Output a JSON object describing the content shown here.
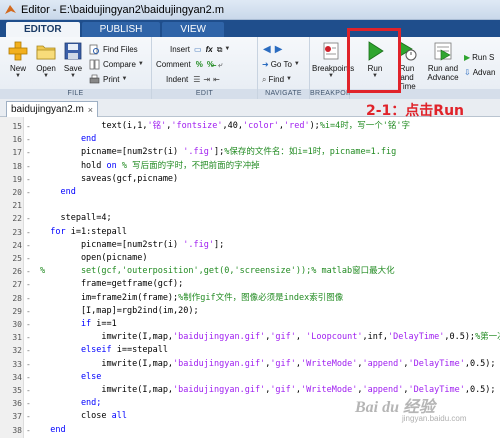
{
  "window": {
    "title": "Editor - E:\\baidujingyan2\\baidujingyan2.m"
  },
  "ribbon_tabs": [
    "EDITOR",
    "PUBLISH",
    "VIEW"
  ],
  "file_group": {
    "label": "FILE",
    "new": "New",
    "open": "Open",
    "save": "Save",
    "find_files": "Find Files",
    "compare": "Compare",
    "print": "Print"
  },
  "edit_group": {
    "label": "EDIT",
    "insert": "Insert",
    "comment": "Comment",
    "indent": "Indent"
  },
  "navigate_group": {
    "label": "NAVIGATE",
    "go_to": "Go To",
    "find": "Find"
  },
  "breakpoints_group": {
    "label": "BREAKPOINTS",
    "breakpoints": "Breakpoints"
  },
  "run_group": {
    "run": "Run",
    "run_and_time": "Run and Time",
    "run_and_advance": "Run and Advance",
    "run_section": "Run S",
    "advance": "Advan"
  },
  "doc_tab": {
    "name": "baidujingyan2.m"
  },
  "annotation": "2-1：点击Run",
  "watermark": {
    "main": "Bai du 经验",
    "sub": "jingyan.baidu.com"
  },
  "colors": {
    "highlight": "#e0232a",
    "keyword": "#0000ff",
    "string": "#a020f0",
    "comment": "#228b22"
  },
  "code_lines": [
    {
      "num": "15",
      "parts": [
        [
          "",
          "            text(i,1,"
        ],
        [
          "str",
          "'铭'"
        ],
        [
          "",
          ","
        ],
        [
          "str",
          "'fontsize'"
        ],
        [
          "",
          ",40,"
        ],
        [
          "str",
          "'color'"
        ],
        [
          "",
          ","
        ],
        [
          "str",
          "'red'"
        ],
        [
          "",
          ");"
        ],
        [
          "cmt",
          "%i=4时，写一个'铭'字"
        ]
      ]
    },
    {
      "num": "16",
      "parts": [
        [
          "kw",
          "        end"
        ]
      ]
    },
    {
      "num": "17",
      "parts": [
        [
          "",
          "        picname=[num2str(i) "
        ],
        [
          "str",
          "'.fig'"
        ],
        [
          "",
          "];"
        ],
        [
          "cmt",
          "%保存的文件名：如i=1时，picname=1.fig"
        ]
      ]
    },
    {
      "num": "18",
      "parts": [
        [
          "",
          "        hold "
        ],
        [
          "kw",
          "on"
        ],
        [
          "cmt",
          " % 写后面的字时，不把前面的字冲掉"
        ]
      ]
    },
    {
      "num": "19",
      "parts": [
        [
          "",
          "        saveas(gcf,picname)"
        ]
      ]
    },
    {
      "num": "20",
      "parts": [
        [
          "kw",
          "    end"
        ]
      ]
    },
    {
      "num": "21",
      "parts": [
        [
          "",
          ""
        ]
      ]
    },
    {
      "num": "22",
      "parts": [
        [
          "",
          "    stepall=4;"
        ]
      ]
    },
    {
      "num": "23",
      "parts": [
        [
          "kw",
          "  for"
        ],
        [
          "",
          " i=1:stepall"
        ]
      ]
    },
    {
      "num": "24",
      "parts": [
        [
          "",
          "        picname=[num2str(i) "
        ],
        [
          "str",
          "'.fig'"
        ],
        [
          "",
          "];"
        ]
      ]
    },
    {
      "num": "25",
      "parts": [
        [
          "",
          "        open(picname)"
        ]
      ]
    },
    {
      "num": "26",
      "parts": [
        [
          "cmt",
          "%       set(gcf,'outerposition',get(0,'screensize'));% matlab窗口最大化"
        ]
      ]
    },
    {
      "num": "27",
      "parts": [
        [
          "",
          "        frame=getframe(gcf);"
        ]
      ]
    },
    {
      "num": "28",
      "parts": [
        [
          "",
          "        im=frame2im(frame);"
        ],
        [
          "cmt",
          "%制作gif文件，图像必须是index索引图像"
        ]
      ]
    },
    {
      "num": "29",
      "parts": [
        [
          "",
          "        [I,map]=rgb2ind(im,20);"
        ]
      ]
    },
    {
      "num": "30",
      "parts": [
        [
          "kw",
          "        if"
        ],
        [
          "",
          " i==1"
        ]
      ]
    },
    {
      "num": "31",
      "parts": [
        [
          "",
          "            imwrite(I,map,"
        ],
        [
          "str",
          "'baidujingyan.gif'"
        ],
        [
          "",
          ","
        ],
        [
          "str",
          "'gif'"
        ],
        [
          "",
          ", "
        ],
        [
          "str",
          "'Loopcount'"
        ],
        [
          "",
          ",inf,"
        ],
        [
          "str",
          "'DelayTime'"
        ],
        [
          "",
          ",0.5);"
        ],
        [
          "cmt",
          "%第一次必须创建！"
        ]
      ]
    },
    {
      "num": "32",
      "parts": [
        [
          "kw",
          "        elseif"
        ],
        [
          "",
          " i==stepall"
        ]
      ]
    },
    {
      "num": "33",
      "parts": [
        [
          "",
          "            imwrite(I,map,"
        ],
        [
          "str",
          "'baidujingyan.gif'"
        ],
        [
          "",
          ","
        ],
        [
          "str",
          "'gif'"
        ],
        [
          "",
          ","
        ],
        [
          "str",
          "'WriteMode'"
        ],
        [
          "",
          ","
        ],
        [
          "str",
          "'append'"
        ],
        [
          "",
          ","
        ],
        [
          "str",
          "'DelayTime'"
        ],
        [
          "",
          ",0.5);"
        ]
      ]
    },
    {
      "num": "34",
      "parts": [
        [
          "kw",
          "        else"
        ]
      ]
    },
    {
      "num": "35",
      "parts": [
        [
          "",
          "            imwrite(I,map,"
        ],
        [
          "str",
          "'baidujingyan.gif'"
        ],
        [
          "",
          ","
        ],
        [
          "str",
          "'gif'"
        ],
        [
          "",
          ","
        ],
        [
          "str",
          "'WriteMode'"
        ],
        [
          "",
          ","
        ],
        [
          "str",
          "'append'"
        ],
        [
          "",
          ","
        ],
        [
          "str",
          "'DelayTime'"
        ],
        [
          "",
          ",0.5);"
        ]
      ]
    },
    {
      "num": "36",
      "parts": [
        [
          "kw",
          "        end;"
        ]
      ]
    },
    {
      "num": "37",
      "parts": [
        [
          "",
          "        close "
        ],
        [
          "kw",
          "all"
        ]
      ]
    },
    {
      "num": "38",
      "parts": [
        [
          "kw",
          "  end"
        ]
      ]
    }
  ]
}
